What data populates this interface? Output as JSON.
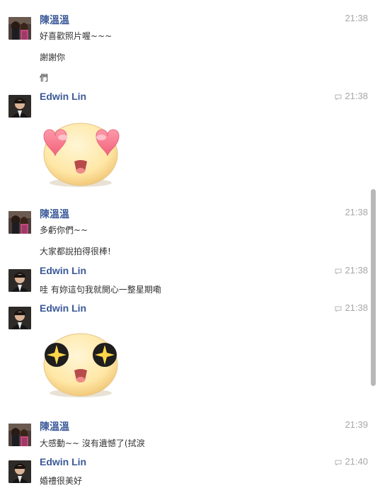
{
  "messages": [
    {
      "sender": "陳溫溫",
      "time": "21:38",
      "seen": false,
      "lines": [
        "好喜歡照片喔~~~",
        "謝謝你",
        "們"
      ]
    },
    {
      "sender": "Edwin Lin",
      "time": "21:38",
      "seen": true,
      "sticker": "heart-eyes-sticker"
    },
    {
      "sender": "陳溫溫",
      "time": "21:38",
      "seen": false,
      "lines": [
        "多虧你們~~",
        "大家都說拍得很棒!"
      ]
    },
    {
      "sender": "Edwin Lin",
      "time": "21:38",
      "seen": true,
      "lines": [
        "哇 有妳這句我就開心一整星期嘞"
      ]
    },
    {
      "sender": "Edwin Lin",
      "time": "21:38",
      "seen": true,
      "sticker": "sparkle-eyes-sticker"
    },
    {
      "sender": "陳溫溫",
      "time": "21:39",
      "seen": false,
      "lines": [
        "大感動~~ 沒有遺憾了(拭淚"
      ]
    },
    {
      "sender": "Edwin Lin",
      "time": "21:40",
      "seen": true,
      "lines": [
        "婚禮很美好"
      ]
    }
  ],
  "colors": {
    "sender_name": "#3b5998",
    "timestamp": "#a7a7a7",
    "message_text": "#333333",
    "scroll_thumb": "#b8b8b8"
  },
  "icons": {
    "seen": "chat-bubble-icon",
    "avatar_wen": "couple-photo-avatar",
    "avatar_edwin": "man-photo-avatar"
  }
}
